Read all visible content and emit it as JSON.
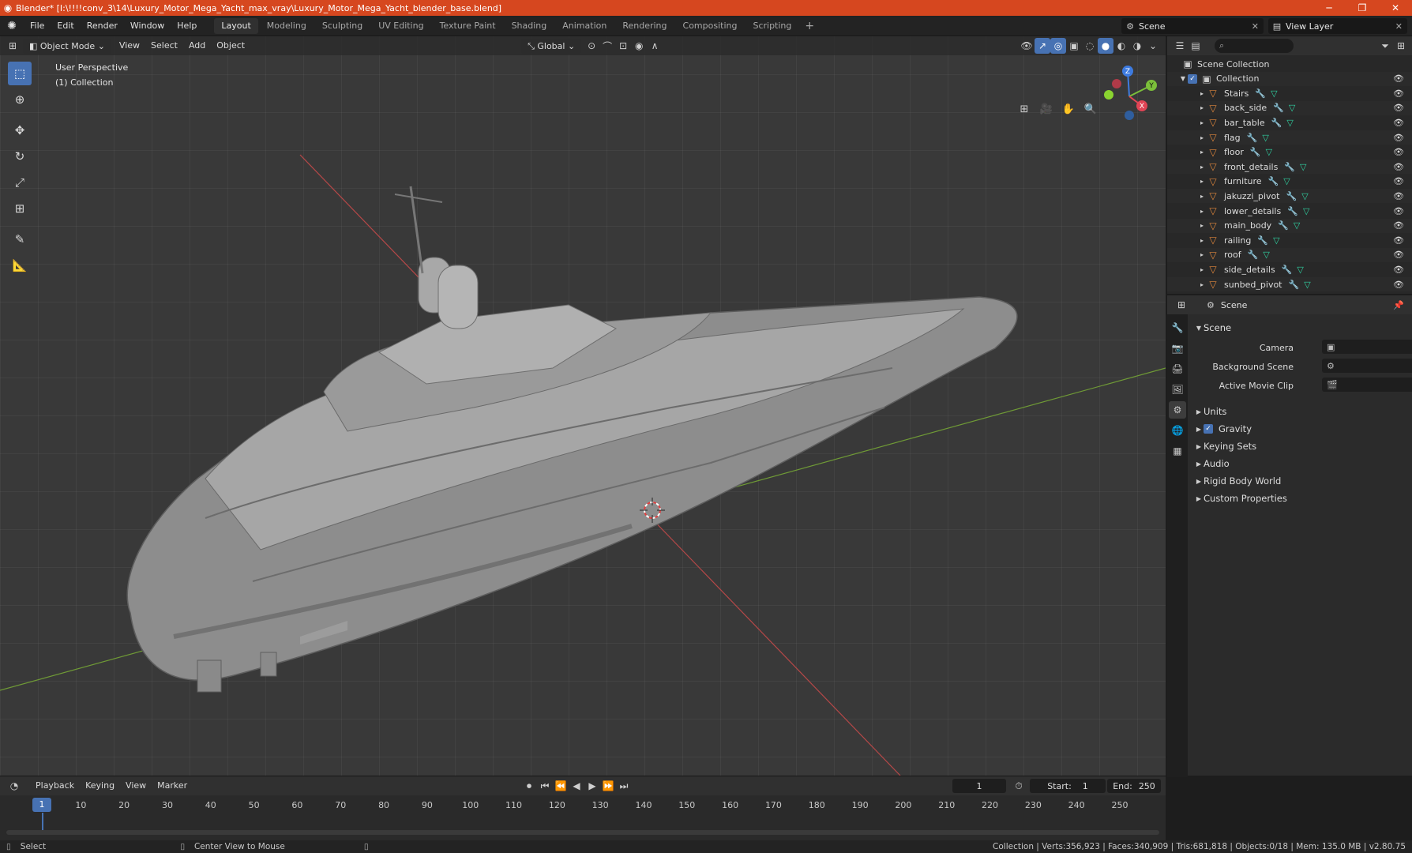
{
  "window": {
    "title": "Blender* [I:\\!!!!conv_3\\14\\Luxury_Motor_Mega_Yacht_max_vray\\Luxury_Motor_Mega_Yacht_blender_base.blend]",
    "minimize": "─",
    "restore": "❐",
    "close": "✕"
  },
  "menu": [
    "File",
    "Edit",
    "Render",
    "Window",
    "Help"
  ],
  "workspaces": [
    "Layout",
    "Modeling",
    "Sculpting",
    "UV Editing",
    "Texture Paint",
    "Shading",
    "Animation",
    "Rendering",
    "Compositing",
    "Scripting"
  ],
  "workspace_add": "+",
  "scene": {
    "name": "Scene",
    "view_layer": "View Layer"
  },
  "viewport": {
    "mode": "Object Mode",
    "menus": [
      "View",
      "Select",
      "Add",
      "Object"
    ],
    "orientation": "Global",
    "info_line1": "User Perspective",
    "info_line2": "(1) Collection",
    "gizmo": {
      "x": "X",
      "y": "Y",
      "z": "Z"
    }
  },
  "outliner": {
    "root": "Scene Collection",
    "collection": "Collection",
    "objects": [
      "Stairs",
      "back_side",
      "bar_table",
      "flag",
      "floor",
      "front_details",
      "furniture",
      "jakuzzi_pivot",
      "lower_details",
      "main_body",
      "railing",
      "roof",
      "side_details",
      "sunbed_pivot"
    ]
  },
  "properties": {
    "context": "Scene",
    "panel": "Scene",
    "camera_label": "Camera",
    "background_label": "Background Scene",
    "movieclip_label": "Active Movie Clip",
    "subpanels": [
      "Units",
      "Gravity",
      "Keying Sets",
      "Audio",
      "Rigid Body World",
      "Custom Properties"
    ]
  },
  "timeline": {
    "menus": [
      "Playback",
      "Keying",
      "View",
      "Marker"
    ],
    "current_frame": "1",
    "start_label": "Start:",
    "start": "1",
    "end_label": "End:",
    "end": "250",
    "ticks": [
      "1",
      "10",
      "20",
      "30",
      "40",
      "50",
      "60",
      "70",
      "80",
      "90",
      "100",
      "110",
      "120",
      "130",
      "140",
      "150",
      "160",
      "170",
      "180",
      "190",
      "200",
      "210",
      "220",
      "230",
      "240",
      "250"
    ]
  },
  "status": {
    "left": "Select",
    "middle": "Center View to Mouse",
    "right": "Collection | Verts:356,923 | Faces:340,909 | Tris:681,818 | Objects:0/18 | Mem: 135.0 MB | v2.80.75"
  },
  "colors": {
    "accent": "#4772b3",
    "titlebar": "#d6471f",
    "object": "#e0873c"
  }
}
